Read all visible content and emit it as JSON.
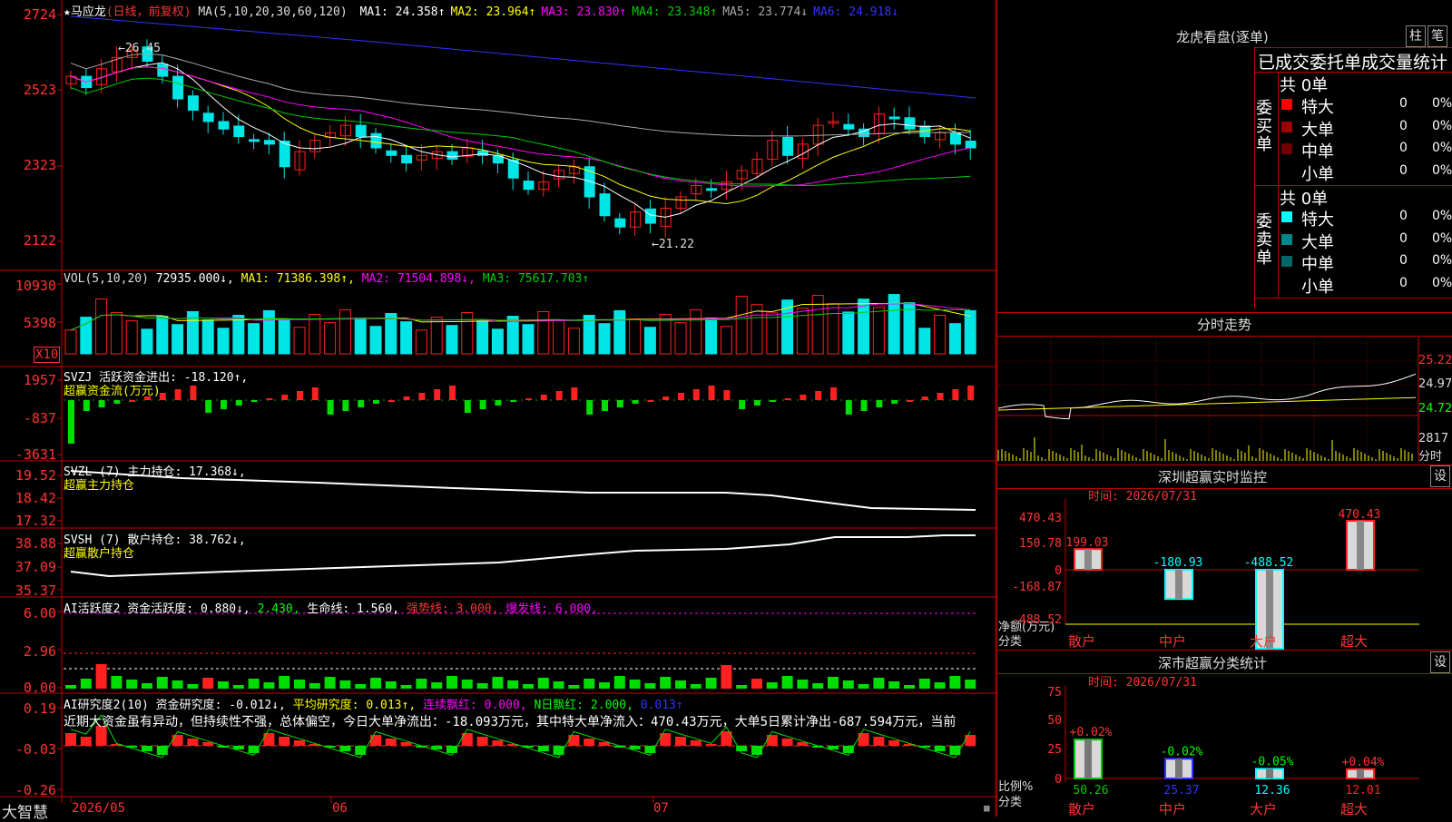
{
  "stock": {
    "name": "马应龙",
    "mode": "(日线，前复权)"
  },
  "main_header": {
    "ma_params": "MA(5,10,20,30,60,120)",
    "items": [
      {
        "label": "MA1:",
        "value": "24.358↑",
        "color": "#ffffff"
      },
      {
        "label": "MA2:",
        "value": "23.964↑",
        "color": "#ffff00"
      },
      {
        "label": "MA3:",
        "value": "23.830↑",
        "color": "#ff00ff"
      },
      {
        "label": "MA4:",
        "value": "23.348↑",
        "color": "#00cc00"
      },
      {
        "label": "MA5:",
        "value": "23.774↓",
        "color": "#aaaaaa"
      },
      {
        "label": "MA6:",
        "value": "24.918↓",
        "color": "#3333ff"
      }
    ]
  },
  "price_axis": [
    "2724",
    "2523",
    "2323",
    "2122"
  ],
  "annotations": {
    "high": "26.45",
    "low": "21.22"
  },
  "vol": {
    "header": "VOL(5,10,20)",
    "value": "72935.000↓,",
    "ma1": "MA1: 71386.398↑,",
    "ma2": "MA2: 71504.898↓,",
    "ma3": "MA3: 75617.703↑",
    "axis": [
      "10930",
      "5398"
    ],
    "unit": "X10"
  },
  "svzj": {
    "header": "SVZJ  活跃资金进出: -18.120↑,",
    "sub": "超赢资金流(万元)",
    "axis": [
      "1957",
      "-837",
      "-3631"
    ]
  },
  "svzl": {
    "header": "SVZL (7) 主力持仓: 17.368↓,",
    "sub": "超赢主力持仓",
    "axis": [
      "19.52",
      "18.42",
      "17.32"
    ]
  },
  "svsh": {
    "header": "SVSH (7) 散户持仓: 38.762↓,",
    "sub": "超赢散户持仓",
    "axis": [
      "38.88",
      "37.09",
      "35.37"
    ]
  },
  "ai_activity": {
    "header_a": "AI活跃度2 资金活跃度: 0.880↓,",
    "header_b": "2.430,",
    "header_c": "生命线: 1.560,",
    "header_d": "强势线: 3.000,",
    "header_e": "爆发线: 6.000,",
    "axis": [
      "6.00",
      "2.96",
      "0.00"
    ]
  },
  "ai_research": {
    "header_a": "AI研究度2(10) 资金研究度: -0.012↓,",
    "header_b": "平均研究度: 0.013↑,",
    "header_c": "连续飘红: 0.000,",
    "header_d": "N日飘红: 2.000,",
    "header_e": "0.013↑",
    "commentary": "近期大资金虽有异动，但持续性不强，总体偏空，今日大单净流出：-18.093万元，其中特大单净流入：470.43万元，大单5日累计净出-687.594万元，当前",
    "axis": [
      "0.19",
      "-0.03",
      "-0.26"
    ]
  },
  "date_axis": [
    "2026/05",
    "06",
    "07"
  ],
  "brand": "大智慧",
  "right": {
    "dragon_title": "龙虎看盘(逐单)",
    "btn_pillar": "柱",
    "btn_pen": "笔",
    "stats_title": "已成交委托单成交量统计",
    "buy_label": "委买单",
    "sell_label": "委卖单",
    "buy_total": "共 0单",
    "sell_total": "共 0单",
    "buy_rows": [
      {
        "label": "特大",
        "count": "0",
        "pct": "0%",
        "color": "#ff0000"
      },
      {
        "label": "大单",
        "count": "0",
        "pct": "0%",
        "color": "#a00000"
      },
      {
        "label": "中单",
        "count": "0",
        "pct": "0%",
        "color": "#700000"
      },
      {
        "label": "小单",
        "count": "0",
        "pct": "0%",
        "color": "#000000"
      }
    ],
    "sell_rows": [
      {
        "label": "特大",
        "count": "0",
        "pct": "0%",
        "color": "#00ffff"
      },
      {
        "label": "大单",
        "count": "0",
        "pct": "0%",
        "color": "#008888"
      },
      {
        "label": "中单",
        "count": "0",
        "pct": "0%",
        "color": "#006666"
      },
      {
        "label": "小单",
        "count": "0",
        "pct": "0%",
        "color": "#000000"
      }
    ],
    "intraday_title": "分时走势",
    "intraday_axis": [
      "25.22",
      "24.97",
      "24.72"
    ],
    "intraday_vol": "2817",
    "intraday_vol_unit": "分时",
    "monitor_title": "深圳超赢实时监控",
    "monitor_btn": "设",
    "monitor_time": "时间: 2026/07/31",
    "monitor_axis": [
      "470.43",
      "150.78",
      "0",
      "-168.87",
      "-488.52"
    ],
    "monitor_ylabel": "净额(万元)",
    "monitor_xlabel": "分类",
    "monitor_bars": [
      {
        "cat": "散户",
        "value": 199.03,
        "label": "199.03"
      },
      {
        "cat": "中户",
        "value": -180.93,
        "label": "-180.93"
      },
      {
        "cat": "大户",
        "value": -488.52,
        "label": "-488.52"
      },
      {
        "cat": "超大",
        "value": 470.43,
        "label": "470.43"
      }
    ],
    "class_title": "深市超赢分类统计",
    "class_btn": "设",
    "class_time": "时间: 2026/07/31",
    "class_axis": [
      "75",
      "50",
      "25",
      "0"
    ],
    "class_ylabel": "比例%",
    "class_xlabel": "分类",
    "class_bars": [
      {
        "cat": "散户",
        "value": 50.26,
        "label": "50.26",
        "delta": "+0.02%"
      },
      {
        "cat": "中户",
        "value": 25.37,
        "label": "25.37",
        "delta": "-0.02%"
      },
      {
        "cat": "大户",
        "value": 12.36,
        "label": "12.36",
        "delta": "-0.05%"
      },
      {
        "cat": "超大",
        "value": 12.01,
        "label": "12.01",
        "delta": "+0.04%"
      }
    ]
  }
}
